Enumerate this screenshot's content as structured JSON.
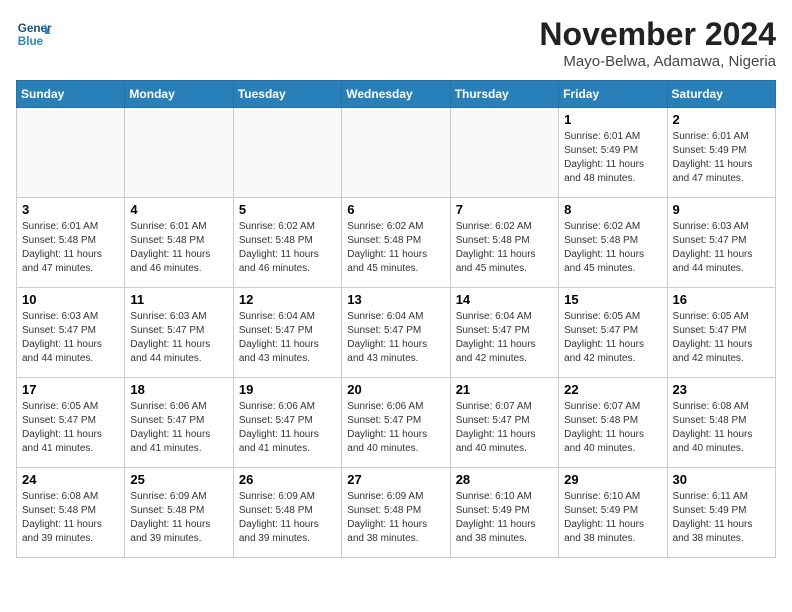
{
  "logo": {
    "line1": "General",
    "line2": "Blue"
  },
  "title": "November 2024",
  "location": "Mayo-Belwa, Adamawa, Nigeria",
  "weekdays": [
    "Sunday",
    "Monday",
    "Tuesday",
    "Wednesday",
    "Thursday",
    "Friday",
    "Saturday"
  ],
  "weeks": [
    [
      {
        "day": "",
        "info": ""
      },
      {
        "day": "",
        "info": ""
      },
      {
        "day": "",
        "info": ""
      },
      {
        "day": "",
        "info": ""
      },
      {
        "day": "",
        "info": ""
      },
      {
        "day": "1",
        "info": "Sunrise: 6:01 AM\nSunset: 5:49 PM\nDaylight: 11 hours\nand 48 minutes."
      },
      {
        "day": "2",
        "info": "Sunrise: 6:01 AM\nSunset: 5:49 PM\nDaylight: 11 hours\nand 47 minutes."
      }
    ],
    [
      {
        "day": "3",
        "info": "Sunrise: 6:01 AM\nSunset: 5:48 PM\nDaylight: 11 hours\nand 47 minutes."
      },
      {
        "day": "4",
        "info": "Sunrise: 6:01 AM\nSunset: 5:48 PM\nDaylight: 11 hours\nand 46 minutes."
      },
      {
        "day": "5",
        "info": "Sunrise: 6:02 AM\nSunset: 5:48 PM\nDaylight: 11 hours\nand 46 minutes."
      },
      {
        "day": "6",
        "info": "Sunrise: 6:02 AM\nSunset: 5:48 PM\nDaylight: 11 hours\nand 45 minutes."
      },
      {
        "day": "7",
        "info": "Sunrise: 6:02 AM\nSunset: 5:48 PM\nDaylight: 11 hours\nand 45 minutes."
      },
      {
        "day": "8",
        "info": "Sunrise: 6:02 AM\nSunset: 5:48 PM\nDaylight: 11 hours\nand 45 minutes."
      },
      {
        "day": "9",
        "info": "Sunrise: 6:03 AM\nSunset: 5:47 PM\nDaylight: 11 hours\nand 44 minutes."
      }
    ],
    [
      {
        "day": "10",
        "info": "Sunrise: 6:03 AM\nSunset: 5:47 PM\nDaylight: 11 hours\nand 44 minutes."
      },
      {
        "day": "11",
        "info": "Sunrise: 6:03 AM\nSunset: 5:47 PM\nDaylight: 11 hours\nand 44 minutes."
      },
      {
        "day": "12",
        "info": "Sunrise: 6:04 AM\nSunset: 5:47 PM\nDaylight: 11 hours\nand 43 minutes."
      },
      {
        "day": "13",
        "info": "Sunrise: 6:04 AM\nSunset: 5:47 PM\nDaylight: 11 hours\nand 43 minutes."
      },
      {
        "day": "14",
        "info": "Sunrise: 6:04 AM\nSunset: 5:47 PM\nDaylight: 11 hours\nand 42 minutes."
      },
      {
        "day": "15",
        "info": "Sunrise: 6:05 AM\nSunset: 5:47 PM\nDaylight: 11 hours\nand 42 minutes."
      },
      {
        "day": "16",
        "info": "Sunrise: 6:05 AM\nSunset: 5:47 PM\nDaylight: 11 hours\nand 42 minutes."
      }
    ],
    [
      {
        "day": "17",
        "info": "Sunrise: 6:05 AM\nSunset: 5:47 PM\nDaylight: 11 hours\nand 41 minutes."
      },
      {
        "day": "18",
        "info": "Sunrise: 6:06 AM\nSunset: 5:47 PM\nDaylight: 11 hours\nand 41 minutes."
      },
      {
        "day": "19",
        "info": "Sunrise: 6:06 AM\nSunset: 5:47 PM\nDaylight: 11 hours\nand 41 minutes."
      },
      {
        "day": "20",
        "info": "Sunrise: 6:06 AM\nSunset: 5:47 PM\nDaylight: 11 hours\nand 40 minutes."
      },
      {
        "day": "21",
        "info": "Sunrise: 6:07 AM\nSunset: 5:47 PM\nDaylight: 11 hours\nand 40 minutes."
      },
      {
        "day": "22",
        "info": "Sunrise: 6:07 AM\nSunset: 5:48 PM\nDaylight: 11 hours\nand 40 minutes."
      },
      {
        "day": "23",
        "info": "Sunrise: 6:08 AM\nSunset: 5:48 PM\nDaylight: 11 hours\nand 40 minutes."
      }
    ],
    [
      {
        "day": "24",
        "info": "Sunrise: 6:08 AM\nSunset: 5:48 PM\nDaylight: 11 hours\nand 39 minutes."
      },
      {
        "day": "25",
        "info": "Sunrise: 6:09 AM\nSunset: 5:48 PM\nDaylight: 11 hours\nand 39 minutes."
      },
      {
        "day": "26",
        "info": "Sunrise: 6:09 AM\nSunset: 5:48 PM\nDaylight: 11 hours\nand 39 minutes."
      },
      {
        "day": "27",
        "info": "Sunrise: 6:09 AM\nSunset: 5:48 PM\nDaylight: 11 hours\nand 38 minutes."
      },
      {
        "day": "28",
        "info": "Sunrise: 6:10 AM\nSunset: 5:49 PM\nDaylight: 11 hours\nand 38 minutes."
      },
      {
        "day": "29",
        "info": "Sunrise: 6:10 AM\nSunset: 5:49 PM\nDaylight: 11 hours\nand 38 minutes."
      },
      {
        "day": "30",
        "info": "Sunrise: 6:11 AM\nSunset: 5:49 PM\nDaylight: 11 hours\nand 38 minutes."
      }
    ]
  ]
}
